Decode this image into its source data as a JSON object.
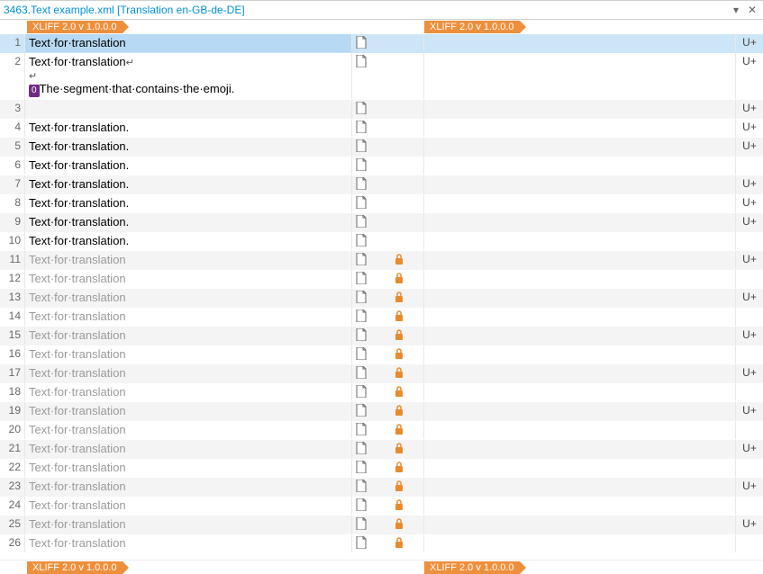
{
  "title": "3463.Text example.xml [Translation en-GB-de-DE]",
  "format_tag": "XLIFF 2.0 v 1.0.0.0",
  "u_label": "U+",
  "inline_tag_label": "0",
  "segments": [
    {
      "num": 1,
      "src": "Text·for·translation",
      "selected": true,
      "locked": false,
      "u": true,
      "doc": true
    },
    {
      "num": 2,
      "src": "Text·for·translation",
      "multiline": true,
      "extra": "The·segment·that·contains·the·emoji.",
      "locked": false,
      "u": true,
      "doc": true
    },
    {
      "num": 3,
      "src": "",
      "locked": false,
      "u": true,
      "doc": true,
      "alt": true
    },
    {
      "num": 4,
      "src": "Text·for·translation.",
      "locked": false,
      "u": true,
      "doc": true
    },
    {
      "num": 5,
      "src": "Text·for·translation.",
      "locked": false,
      "u": true,
      "doc": true,
      "alt": true
    },
    {
      "num": 6,
      "src": "Text·for·translation.",
      "locked": false,
      "u": false,
      "doc": true
    },
    {
      "num": 7,
      "src": "Text·for·translation.",
      "locked": false,
      "u": true,
      "doc": true,
      "alt": true
    },
    {
      "num": 8,
      "src": "Text·for·translation.",
      "locked": false,
      "u": true,
      "doc": true
    },
    {
      "num": 9,
      "src": "Text·for·translation.",
      "locked": false,
      "u": true,
      "doc": true,
      "alt": true
    },
    {
      "num": 10,
      "src": "Text·for·translation.",
      "locked": false,
      "u": false,
      "doc": true
    },
    {
      "num": 11,
      "src": "Text·for·translation",
      "locked": true,
      "u": true,
      "doc": true,
      "alt": true
    },
    {
      "num": 12,
      "src": "Text·for·translation",
      "locked": true,
      "u": false,
      "doc": true
    },
    {
      "num": 13,
      "src": "Text·for·translation",
      "locked": true,
      "u": true,
      "doc": true,
      "alt": true
    },
    {
      "num": 14,
      "src": "Text·for·translation",
      "locked": true,
      "u": false,
      "doc": true
    },
    {
      "num": 15,
      "src": "Text·for·translation",
      "locked": true,
      "u": true,
      "doc": true,
      "alt": true
    },
    {
      "num": 16,
      "src": "Text·for·translation",
      "locked": true,
      "u": false,
      "doc": true
    },
    {
      "num": 17,
      "src": "Text·for·translation",
      "locked": true,
      "u": true,
      "doc": true,
      "alt": true
    },
    {
      "num": 18,
      "src": "Text·for·translation",
      "locked": true,
      "u": false,
      "doc": true
    },
    {
      "num": 19,
      "src": "Text·for·translation",
      "locked": true,
      "u": true,
      "doc": true,
      "alt": true
    },
    {
      "num": 20,
      "src": "Text·for·translation",
      "locked": true,
      "u": false,
      "doc": true
    },
    {
      "num": 21,
      "src": "Text·for·translation",
      "locked": true,
      "u": true,
      "doc": true,
      "alt": true
    },
    {
      "num": 22,
      "src": "Text·for·translation",
      "locked": true,
      "u": false,
      "doc": true
    },
    {
      "num": 23,
      "src": "Text·for·translation",
      "locked": true,
      "u": true,
      "doc": true,
      "alt": true
    },
    {
      "num": 24,
      "src": "Text·for·translation",
      "locked": true,
      "u": false,
      "doc": true
    },
    {
      "num": 25,
      "src": "Text·for·translation",
      "locked": true,
      "u": true,
      "doc": true,
      "alt": true
    },
    {
      "num": 26,
      "src": "Text·for·translation",
      "locked": true,
      "u": false,
      "doc": true
    }
  ]
}
